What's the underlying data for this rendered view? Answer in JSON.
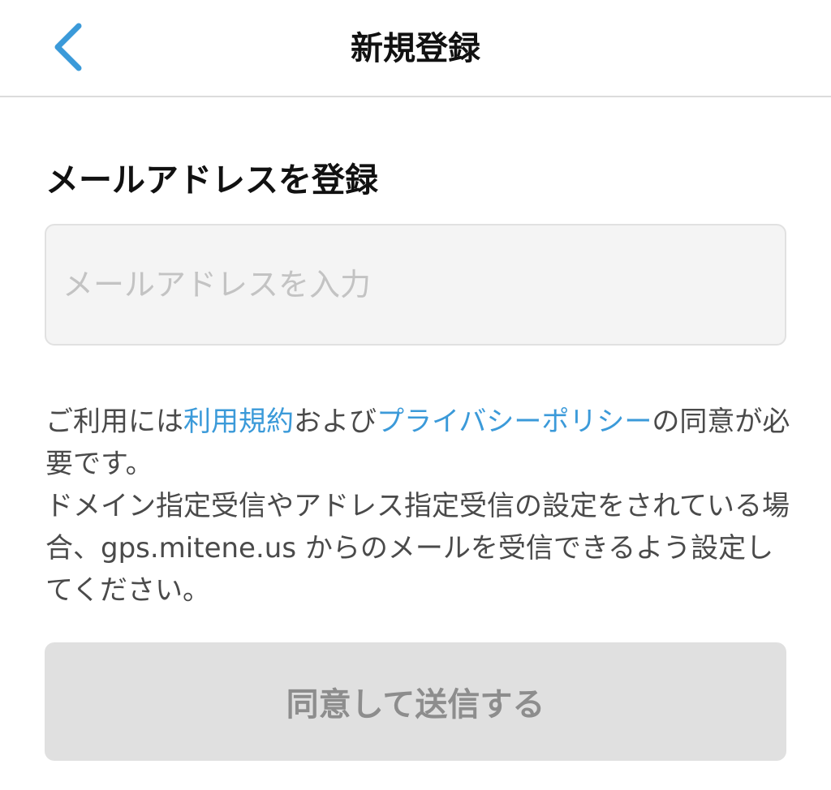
{
  "header": {
    "title": "新規登録",
    "back_icon": "chevron-left-icon"
  },
  "form": {
    "section_title": "メールアドレスを登録",
    "email_placeholder": "メールアドレスを入力",
    "email_value": ""
  },
  "terms": {
    "prefix": "ご利用には",
    "terms_link": "利用規約",
    "and": "および",
    "privacy_link": "プライバシーポリシー",
    "suffix": "の同意が必要です。",
    "note": "ドメイン指定受信やアドレス指定受信の設定をされている場合、gps.mitene.us からのメールを受信できるよう設定してください。"
  },
  "submit": {
    "label": "同意して送信する"
  },
  "colors": {
    "accent": "#3b9ad9",
    "button_disabled_bg": "#e0e0e0",
    "button_disabled_text": "#8d8d8d",
    "input_bg": "#f4f4f4"
  }
}
